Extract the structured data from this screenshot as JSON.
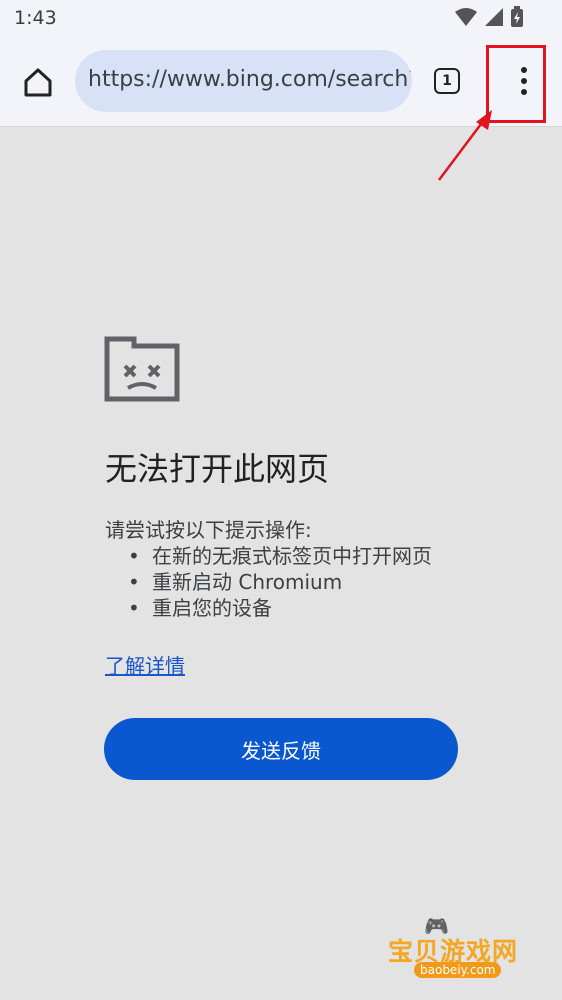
{
  "status_bar": {
    "time": "1:43"
  },
  "toolbar": {
    "url": "https://www.bing.com/search?q=",
    "tab_count": "1"
  },
  "error": {
    "title": "无法打开此网页",
    "suggest_intro": "请尝试按以下提示操作:",
    "suggestions": [
      "在新的无痕式标签页中打开网页",
      "重新启动 Chromium",
      "重启您的设备"
    ],
    "details_link": "了解详情",
    "feedback_button": "发送反馈"
  },
  "watermark": {
    "text": "宝贝游戏网",
    "url": "baobeiy.com"
  },
  "colors": {
    "accent": "#0b57d0",
    "highlight": "#e0141e",
    "page_bg": "#e3e3e3"
  },
  "icons": [
    "wifi-icon",
    "signal-icon",
    "battery-icon",
    "home-icon",
    "tab-switcher-icon",
    "more-vert-icon",
    "sad-page-icon"
  ]
}
